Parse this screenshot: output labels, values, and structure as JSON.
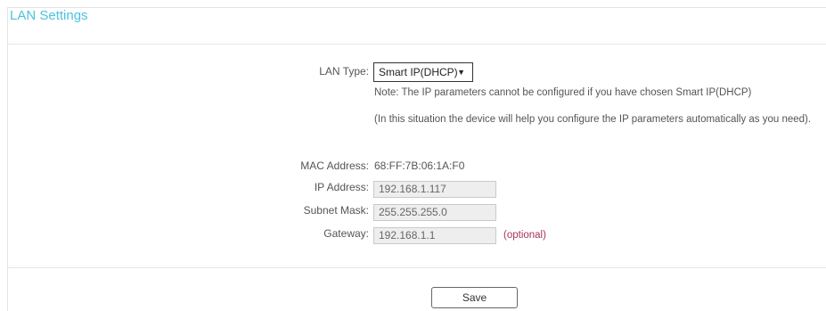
{
  "panel": {
    "title": "LAN Settings"
  },
  "lan_type": {
    "label": "LAN Type:",
    "selected": "Smart IP(DHCP)",
    "note_1": "Note: The IP parameters cannot be configured if you have chosen Smart IP(DHCP)",
    "note_2": "(In this situation the device will help you configure the IP parameters automatically as you need)."
  },
  "mac": {
    "label": "MAC Address:",
    "value": "68:FF:7B:06:1A:F0"
  },
  "ip": {
    "label": "IP Address:",
    "value": "192.168.1.117"
  },
  "subnet": {
    "label": "Subnet Mask:",
    "value": "255.255.255.0"
  },
  "gateway": {
    "label": "Gateway:",
    "value": "192.168.1.1",
    "hint": "(optional)"
  },
  "actions": {
    "save_label": "Save"
  },
  "colors": {
    "title": "#4cc2e0",
    "optional_hint": "#a8325e"
  }
}
